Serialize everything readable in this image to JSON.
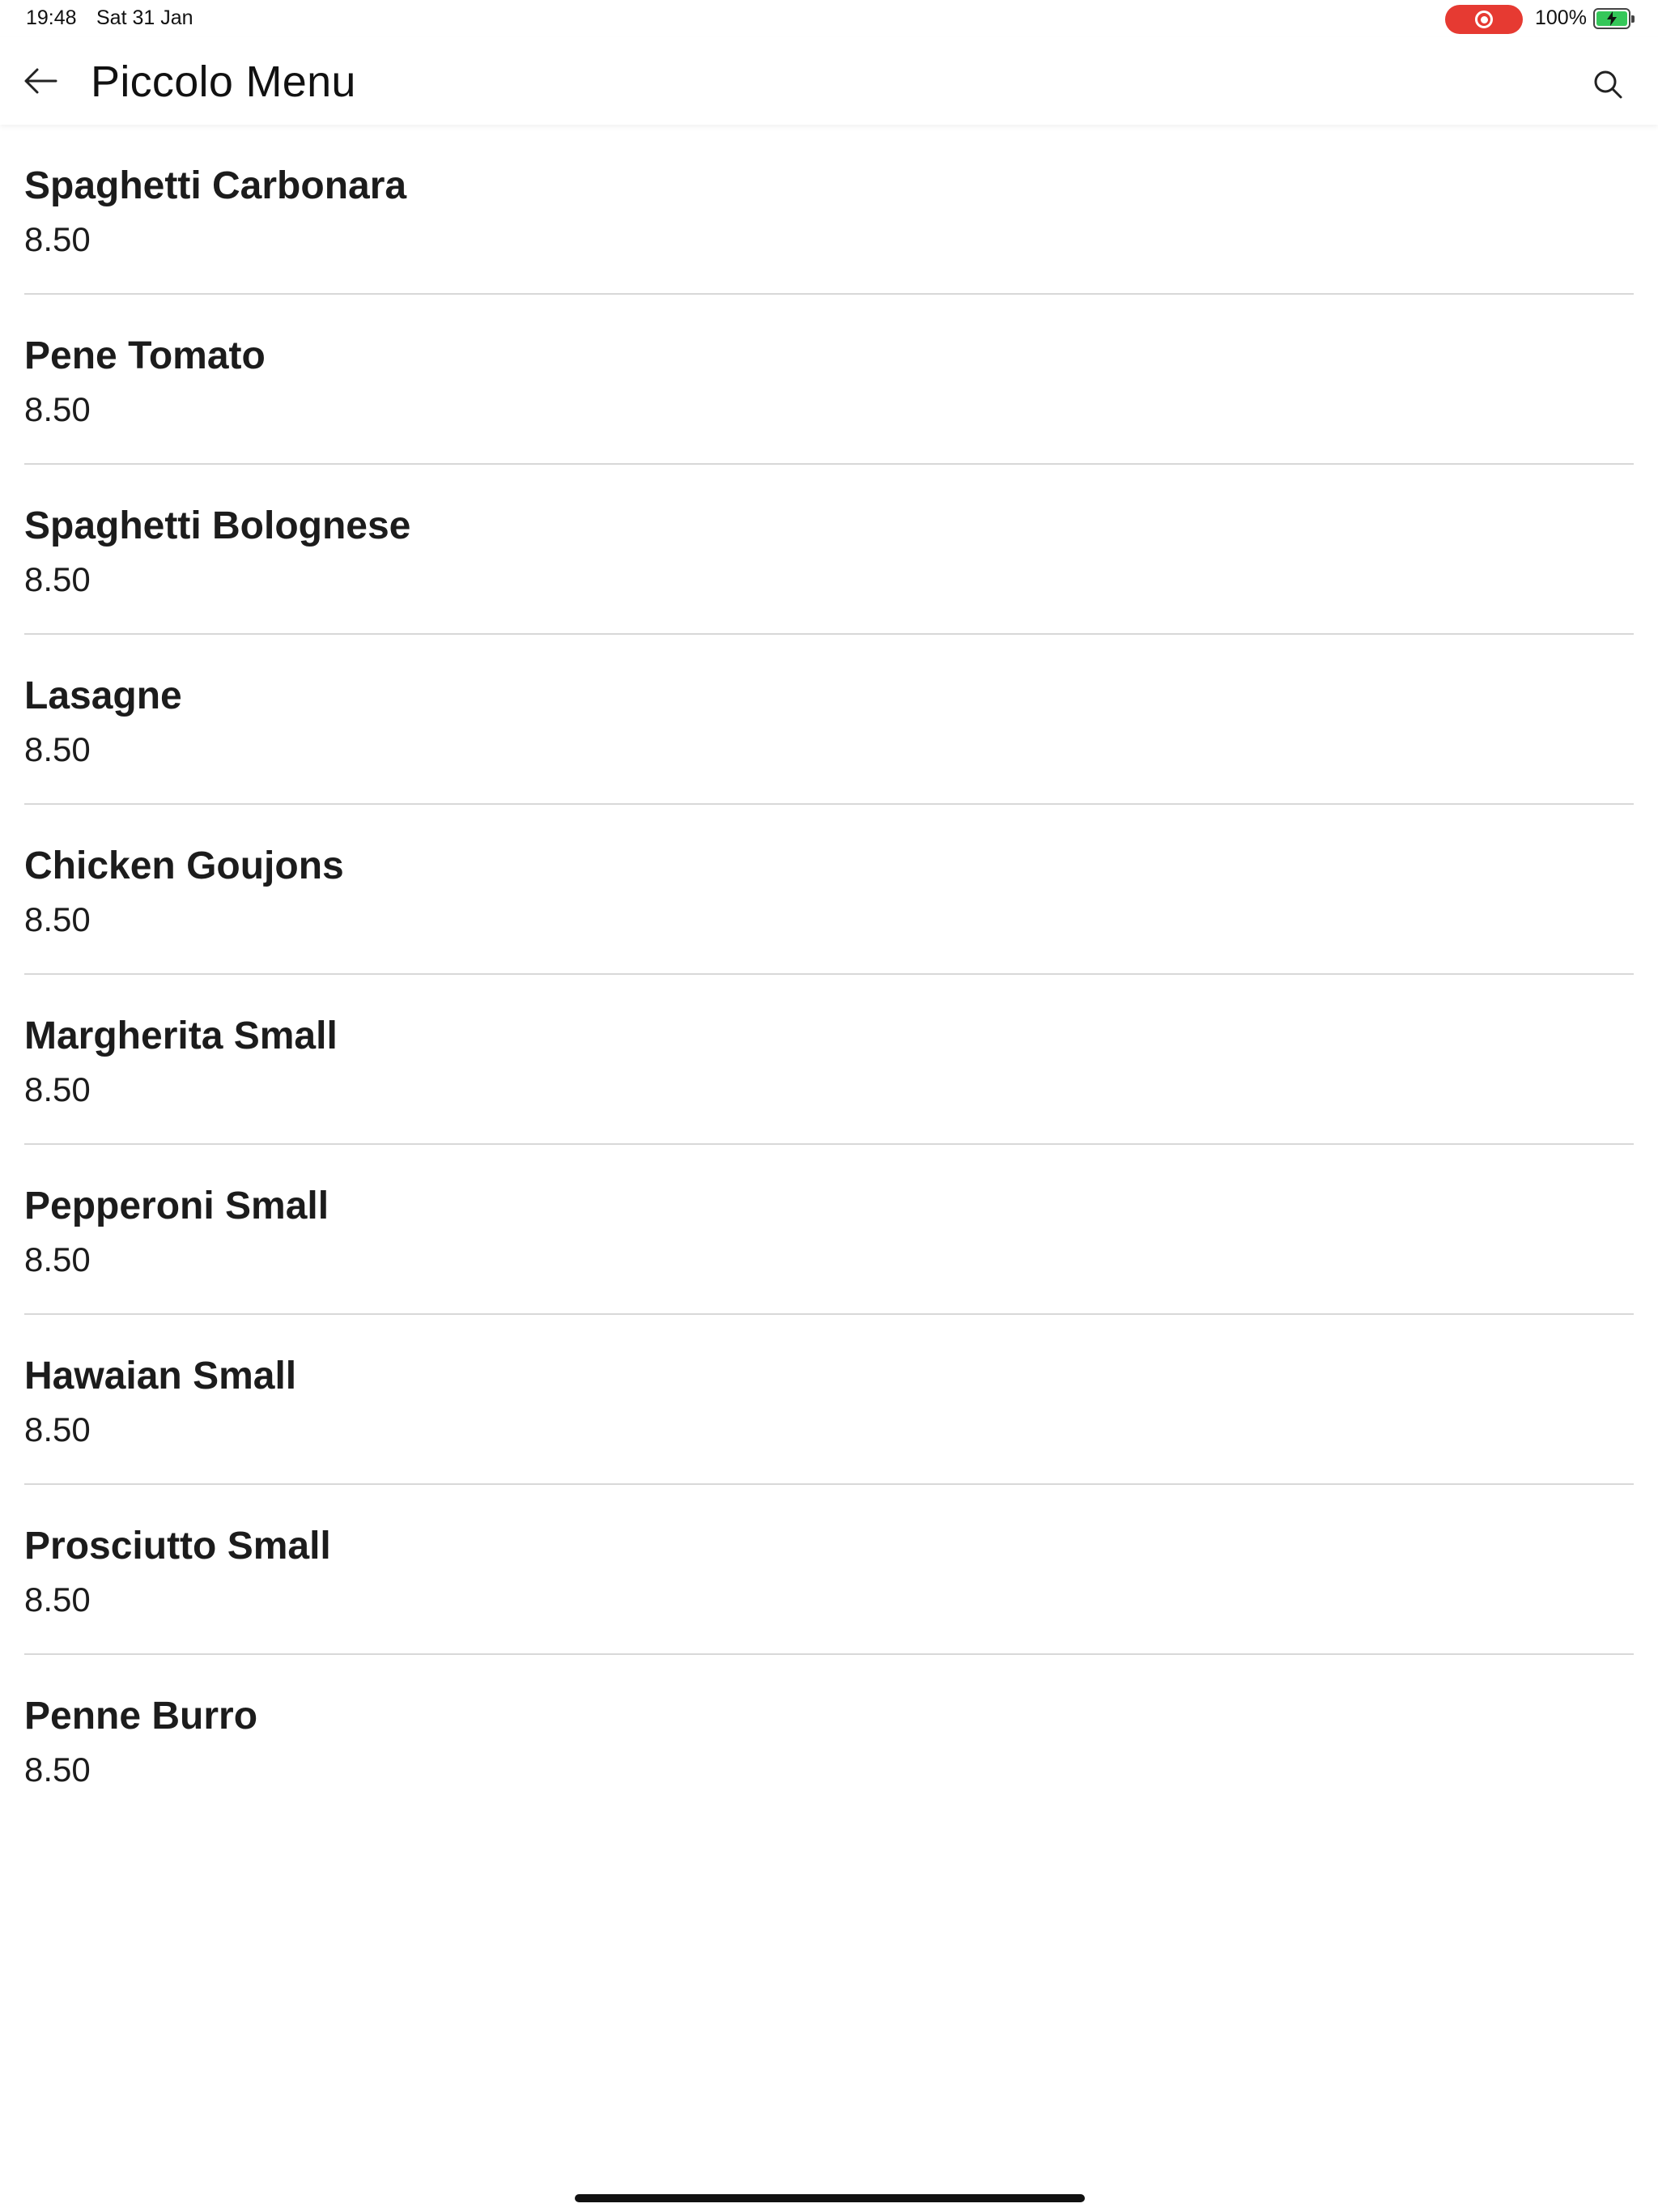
{
  "status_bar": {
    "time": "19:48",
    "date": "Sat 31 Jan",
    "battery_percent": "100%",
    "battery_level": 1.0,
    "battery_charging": true,
    "record_indicator_color": "#e63a32",
    "battery_color": "#35c759"
  },
  "app_bar": {
    "title": "Piccolo Menu",
    "back_icon": "arrow-left-icon",
    "search_icon": "search-icon"
  },
  "menu": {
    "items": [
      {
        "name": "Spaghetti Carbonara",
        "price": "8.50"
      },
      {
        "name": "Pene Tomato",
        "price": "8.50"
      },
      {
        "name": "Spaghetti Bolognese",
        "price": "8.50"
      },
      {
        "name": "Lasagne",
        "price": "8.50"
      },
      {
        "name": "Chicken Goujons",
        "price": "8.50"
      },
      {
        "name": "Margherita Small",
        "price": "8.50"
      },
      {
        "name": "Pepperoni Small",
        "price": "8.50"
      },
      {
        "name": "Hawaian Small",
        "price": "8.50"
      },
      {
        "name": "Prosciutto Small",
        "price": "8.50"
      },
      {
        "name": "Penne Burro",
        "price": "8.50"
      }
    ]
  }
}
